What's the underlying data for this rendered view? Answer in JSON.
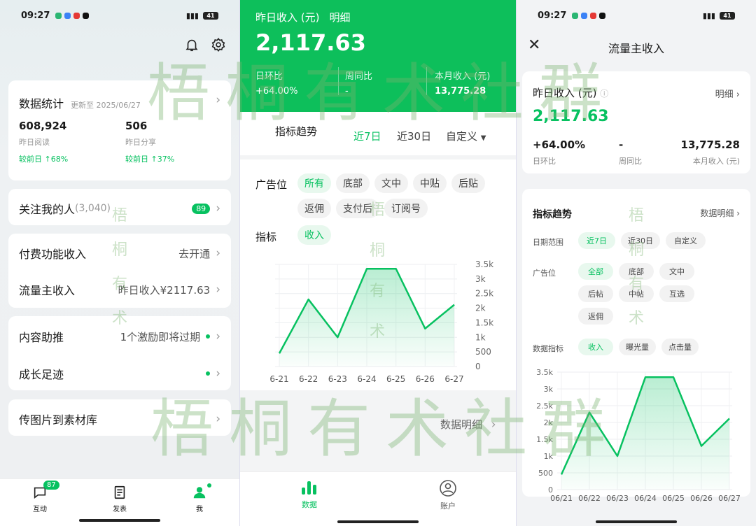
{
  "status": {
    "time": "09:27",
    "battery": "41"
  },
  "left": {
    "stats": {
      "title": "数据统计",
      "updated": "更新至 2025/06/27",
      "reads_value": "608,924",
      "reads_label": "昨日阅读",
      "reads_change": "较前日 ↑68%",
      "shares_value": "506",
      "shares_label": "昨日分享",
      "shares_change": "较前日 ↑37%"
    },
    "followers": {
      "label": "关注我的人",
      "count": "(3,040)",
      "badge": "89"
    },
    "paid": {
      "label": "付费功能收入",
      "action": "去开通"
    },
    "traffic": {
      "label": "流量主收入",
      "value": "昨日收入¥2117.63"
    },
    "promo": {
      "label": "内容助推",
      "value": "1个激励即将过期"
    },
    "growth": {
      "label": "成长足迹"
    },
    "upload": {
      "label": "传图片到素材库"
    },
    "tabs": [
      {
        "label": "互动",
        "badge": "87",
        "icon": "chat-icon"
      },
      {
        "label": "发表",
        "icon": "document-icon"
      },
      {
        "label": "我",
        "icon": "person-icon"
      }
    ]
  },
  "middle": {
    "header": {
      "title": "昨日收入 (元)",
      "detail": "明细",
      "amount": "2,117.63",
      "dod_label": "日环比",
      "dod_value": "+64.00%",
      "wow_label": "周同比",
      "wow_value": "-",
      "month_label": "本月收入 (元)",
      "month_value": "13,775.28"
    },
    "trend_title": "指标趋势",
    "ranges": [
      "近7日",
      "近30日",
      "自定义"
    ],
    "slot_label": "广告位",
    "slots": [
      "所有",
      "底部",
      "文中",
      "中贴",
      "后贴",
      "返佣",
      "支付后",
      "订阅号"
    ],
    "metric_label": "指标",
    "metric": "收入",
    "data_detail": "数据明细",
    "tabs": [
      {
        "label": "数据",
        "icon": "bar-chart-icon"
      },
      {
        "label": "账户",
        "icon": "account-icon"
      }
    ]
  },
  "right": {
    "title": "流量主收入",
    "yesterday_label": "昨日收入 (元)",
    "detail": "明细",
    "amount": "2,117.63",
    "dod_value": "+64.00%",
    "dod_label": "日环比",
    "wow_value": "-",
    "wow_label": "周同比",
    "month_value": "13,775.28",
    "month_label": "本月收入 (元)",
    "trend_title": "指标趋势",
    "data_detail": "数据明细",
    "date_label": "日期范围",
    "ranges": [
      "近7日",
      "近30日",
      "自定义"
    ],
    "slot_label": "广告位",
    "slots": [
      "全部",
      "底部",
      "文中",
      "后帖",
      "中帖",
      "互选",
      "返佣"
    ],
    "metric_label": "数据指标",
    "metrics": [
      "收入",
      "曝光量",
      "点击量"
    ]
  },
  "watermarks": {
    "big": "梧桐有术社群",
    "small": [
      "梧",
      "桐",
      "有",
      "术"
    ]
  },
  "colors": {
    "brand_green": "#07c160",
    "header_green": "#0dbf5b"
  },
  "chart_data": [
    {
      "type": "area",
      "x": [
        "6-21",
        "6-22",
        "6-23",
        "6-24",
        "6-25",
        "6-26",
        "6-27"
      ],
      "series": [
        {
          "values": [
            450,
            2300,
            1000,
            3350,
            3350,
            1300,
            2118
          ]
        }
      ],
      "yticks": [
        "0",
        "500",
        "1k",
        "1.5k",
        "2k",
        "2.5k",
        "3k",
        "3.5k"
      ],
      "ylim": [
        0,
        3500
      ],
      "grid": true
    },
    {
      "type": "area",
      "x": [
        "06/21",
        "06/22",
        "06/23",
        "06/24",
        "06/25",
        "06/26",
        "06/27"
      ],
      "series": [
        {
          "values": [
            450,
            2300,
            1000,
            3350,
            3350,
            1300,
            2118
          ]
        }
      ],
      "yticks": [
        "0",
        "500",
        "1k",
        "1.5k",
        "2k",
        "2.5k",
        "3k",
        "3.5k"
      ],
      "ylim": [
        0,
        3500
      ],
      "grid": true
    }
  ]
}
